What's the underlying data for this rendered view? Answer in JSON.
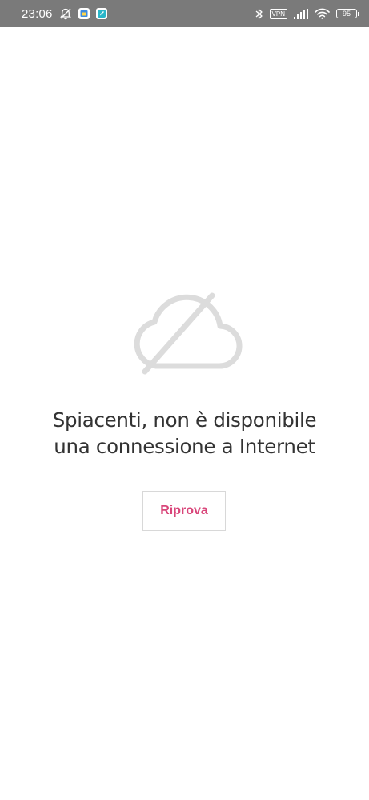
{
  "status_bar": {
    "time": "23:06",
    "vpn_label": "VPN",
    "battery_level": "95",
    "icons": [
      "alarm-off-icon",
      "calendar-app-icon",
      "edit-app-icon",
      "bluetooth-icon",
      "vpn-icon",
      "signal-icon",
      "wifi-icon",
      "battery-icon"
    ]
  },
  "offline": {
    "icon": "cloud-off-icon",
    "message_line1": "Spiacenti, non è disponibile",
    "message_line2": "una connessione a Internet",
    "retry_label": "Riprova"
  },
  "colors": {
    "status_bar_bg": "#7a7a7a",
    "accent": "#d9467a",
    "icon_gray": "#d9d9d9",
    "text": "#333333"
  }
}
